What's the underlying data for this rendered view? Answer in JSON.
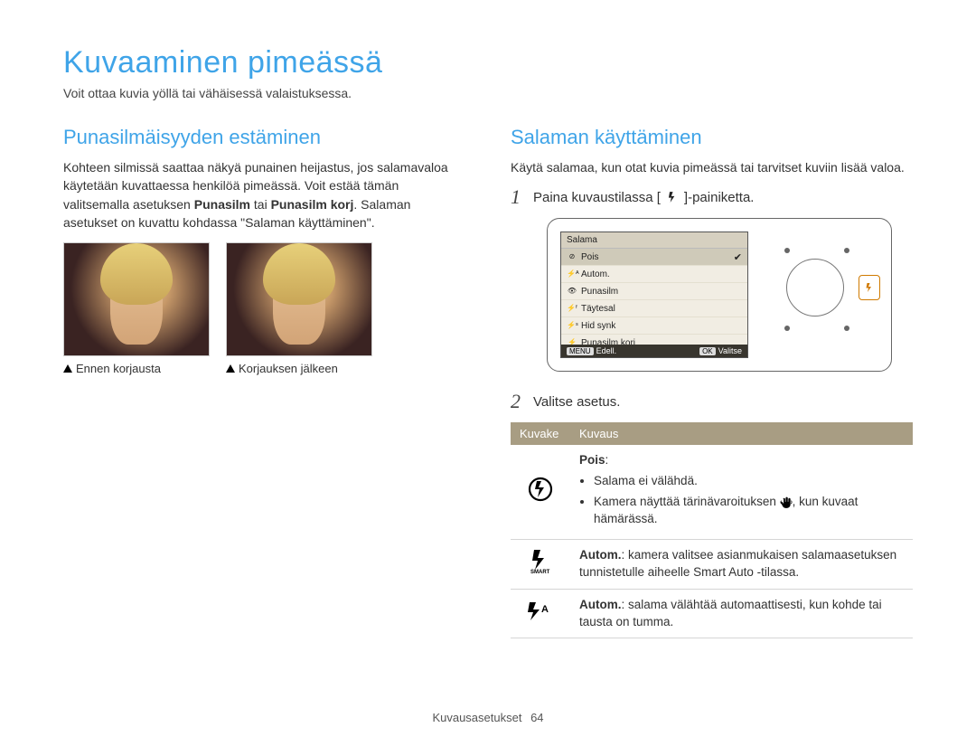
{
  "title": "Kuvaaminen pimeässä",
  "subtitle": "Voit ottaa kuvia yöllä tai vähäisessä valaistuksessa.",
  "left": {
    "heading": "Punasilmäisyyden estäminen",
    "para_before_bold": "Kohteen silmissä saattaa näkyä punainen heijastus, jos salamavaloa käytetään kuvattaessa henkilöä pimeässä. Voit estää tämän valitsemalla asetuksen ",
    "bold1": "Punasilm",
    "mid": " tai ",
    "bold2": "Punasilm korj",
    "after": ". Salaman asetukset on kuvattu kohdassa \"Salaman käyttäminen\".",
    "caption_before": "Ennen korjausta",
    "caption_after": "Korjauksen jälkeen"
  },
  "right": {
    "heading": "Salaman käyttäminen",
    "intro": "Käytä salamaa, kun otat kuvia pimeässä tai tarvitset kuviin lisää valoa.",
    "step1_num": "1",
    "step1_before": "Paina kuvaustilassa [",
    "step1_after": "]-painiketta.",
    "step2_num": "2",
    "step2_text": "Valitse asetus.",
    "menu": {
      "header": "Salama",
      "items": [
        {
          "icon": "⊘",
          "label": "Pois",
          "selected": true
        },
        {
          "icon": "⚡ᴬ",
          "label": "Autom."
        },
        {
          "icon": "👁",
          "label": "Punasilm"
        },
        {
          "icon": "⚡ᶠ",
          "label": "Täytesal"
        },
        {
          "icon": "⚡ˢ",
          "label": "Hid synk"
        },
        {
          "icon": "⚡",
          "label": "Punasilm korj"
        }
      ],
      "footer_left_btn": "MENU",
      "footer_left": "Edell.",
      "footer_right_btn": "OK",
      "footer_right": "Valitse"
    },
    "table": {
      "col1": "Kuvake",
      "col2": "Kuvaus",
      "rows": [
        {
          "glyph": "off",
          "title": "Pois",
          "after_title": ":",
          "bullets": [
            "Salama ei välähdä.",
            "Kamera näyttää tärinävaroituksen {hand}, kun kuvaat hämärässä."
          ]
        },
        {
          "glyph": "smart",
          "title": "Autom.",
          "after_title": ":",
          "desc": " kamera valitsee asianmukaisen salamaasetuksen tunnistetulle aiheelle Smart Auto -tilassa."
        },
        {
          "glyph": "auto",
          "title": "Autom.",
          "after_title": ":",
          "desc": " salama välähtää automaattisesti, kun kohde tai tausta on tumma."
        }
      ]
    }
  },
  "footer": {
    "label": "Kuvausasetukset",
    "page": "64"
  }
}
